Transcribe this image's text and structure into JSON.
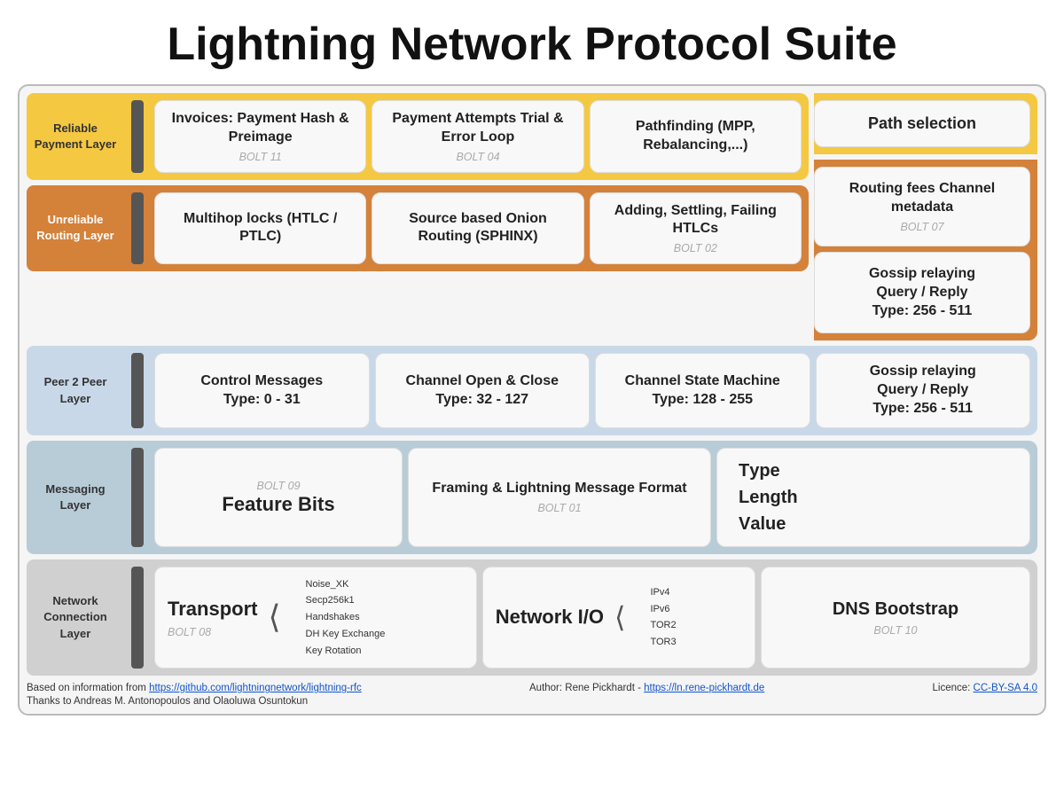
{
  "title": "Lightning Network Protocol Suite",
  "layers": {
    "reliable": {
      "label": "Reliable Payment Layer",
      "cards": [
        {
          "id": "invoices",
          "title": "Invoices: Payment Hash & Preimage",
          "sub": "BOLT 11"
        },
        {
          "id": "payment-attempts",
          "title": "Payment Attempts Trial & Error Loop",
          "sub": "BOLT 04"
        },
        {
          "id": "pathfinding",
          "title": "Pathfinding (MPP, Rebalancing,...)",
          "sub": ""
        }
      ],
      "right_card": {
        "id": "path-selection",
        "title": "Path selection",
        "sub": ""
      }
    },
    "unreliable": {
      "label": "Unreliable Routing Layer",
      "cards": [
        {
          "id": "multihop",
          "title": "Multihop locks (HTLC / PTLC)",
          "sub": ""
        },
        {
          "id": "onion-routing",
          "title": "Source based Onion Routing (SPHINX)",
          "sub": ""
        },
        {
          "id": "htlcs",
          "title": "Adding, Settling, Failing HTLCs",
          "sub": "BOLT 02"
        }
      ],
      "right_cards": [
        {
          "id": "routing-fees",
          "title": "Routing fees Channel metadata",
          "sub": "BOLT 07"
        },
        {
          "id": "gossip",
          "title_bold": "Gossip relaying Query / Reply",
          "title_bold_parts": "Type: 256 - 511",
          "sub": ""
        }
      ]
    },
    "p2p": {
      "label": "Peer 2 Peer Layer",
      "cards": [
        {
          "id": "control-msgs",
          "title": "Control Messages",
          "title_bold": "Type: 0 - 31",
          "sub": ""
        },
        {
          "id": "channel-open-close",
          "title": "Channel Open & Close",
          "title_bold": "Type: 32 - 127",
          "sub": ""
        },
        {
          "id": "channel-state",
          "title": "Channel State Machine",
          "title_bold": "Type: 128 - 255",
          "sub": ""
        }
      ],
      "right_card": {
        "id": "gossip-relay",
        "line1": "Gossip relaying",
        "line2": "Query / Reply",
        "bold": "Type: 256 - 511",
        "sub": ""
      }
    },
    "messaging": {
      "label": "Messaging Layer",
      "cards": [
        {
          "id": "feature-bits",
          "title": "Feature Bits",
          "sub": "BOLT 09"
        },
        {
          "id": "framing",
          "title": "Framing & Lightning Message Format",
          "sub": "BOLT 01"
        },
        {
          "id": "tlv",
          "t": "T",
          "l": "L",
          "v": "V",
          "t_word": "ype",
          "l_word": "ength",
          "v_word": "alue"
        }
      ]
    },
    "network": {
      "label": "Network Connection Layer",
      "transport": {
        "id": "transport",
        "title": "Transport",
        "sub": "BOLT 08",
        "branches": [
          "Noise_XK",
          "Secp256k1",
          "Handshakes",
          "DH Key Exchange",
          "Key Rotation"
        ]
      },
      "network_io": {
        "id": "network-io",
        "title": "Network I/O",
        "branches": [
          "IPv4",
          "IPv6",
          "TOR2",
          "TOR3"
        ]
      },
      "dns": {
        "id": "dns-bootstrap",
        "title": "DNS Bootstrap",
        "sub": "BOLT 10"
      }
    }
  },
  "footer": {
    "left_text": "Based on information from ",
    "left_link": "https://github.com/lightningnetwork/lightning-rfc",
    "center_text": "Author: Rene Pickhardt - ",
    "center_link": "https://ln.rene-pickhardt.de",
    "right_text": "Licence: ",
    "right_link": "CC-BY-SA 4.0",
    "thanks": "Thanks to Andreas M. Antonopoulos and Olaoluwa Osuntokun"
  }
}
